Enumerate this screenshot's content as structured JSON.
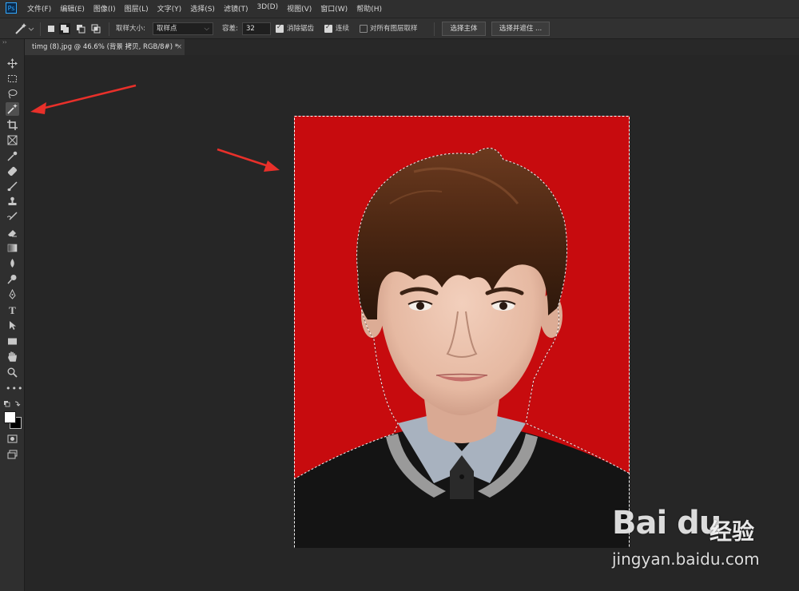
{
  "app": {
    "logo_text": "Ps"
  },
  "menu": {
    "items": [
      "文件(F)",
      "编辑(E)",
      "图像(I)",
      "图层(L)",
      "文字(Y)",
      "选择(S)",
      "滤镜(T)",
      "3D(D)",
      "视图(V)",
      "窗口(W)",
      "帮助(H)"
    ]
  },
  "options": {
    "sample_size_label": "取样大小:",
    "sample_size_value": "取样点",
    "tolerance_label": "容差:",
    "tolerance_value": "32",
    "antialias_label": "消除锯齿",
    "antialias_checked": true,
    "contiguous_label": "连续",
    "contiguous_checked": true,
    "sample_all_label": "对所有图层取样",
    "sample_all_checked": false,
    "select_subject_label": "选择主体",
    "select_mask_label": "选择并遮住 ..."
  },
  "document": {
    "tab_title": "timg (8).jpg @ 46.6% (背景 拷贝, RGB/8#) *",
    "close_glyph": "×"
  },
  "tools": [
    "move-tool",
    "marquee-tool",
    "lasso-tool",
    "magic-wand-tool",
    "crop-tool",
    "frame-tool",
    "eyedropper-tool",
    "healing-brush-tool",
    "brush-tool",
    "clone-stamp-tool",
    "history-brush-tool",
    "eraser-tool",
    "gradient-tool",
    "blur-tool",
    "dodge-tool",
    "pen-tool",
    "type-tool",
    "path-selection-tool",
    "rectangle-tool",
    "hand-tool",
    "zoom-tool",
    "edit-toolbar"
  ],
  "active_tool": "magic-wand-tool",
  "colors": {
    "photo_background": "#c70b0e",
    "annotation_arrow": "#e8302a",
    "foreground": "#ffffff",
    "background": "#000000"
  },
  "watermark": {
    "logo": "Bai du",
    "name_cn": "经验",
    "url": "jingyan.baidu.com"
  }
}
